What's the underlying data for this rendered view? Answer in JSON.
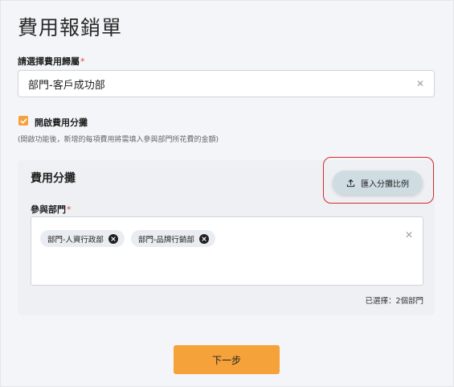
{
  "page": {
    "title": "費用報銷單"
  },
  "belong": {
    "label": "請選擇費用歸屬",
    "required_mark": "*",
    "value": "部門-客戶成功部",
    "clear_icon": "close-icon"
  },
  "split_toggle": {
    "label": "開啟費用分攤",
    "checked": true,
    "hint": "(開啟功能後，新增的每項費用將需填入參與部門所花費的金額)",
    "accent": "#f6a13a"
  },
  "split_card": {
    "title": "費用分攤",
    "import_button": {
      "label": "匯入分攤比例",
      "icon": "upload-icon"
    },
    "participants": {
      "label": "參與部門",
      "required_mark": "*",
      "tags": [
        "部門-人資行政部",
        "部門-品牌行銷部"
      ],
      "count_text": "已選擇：2個部門"
    }
  },
  "footer": {
    "next_label": "下一步",
    "next_color": "#f6a23a"
  }
}
